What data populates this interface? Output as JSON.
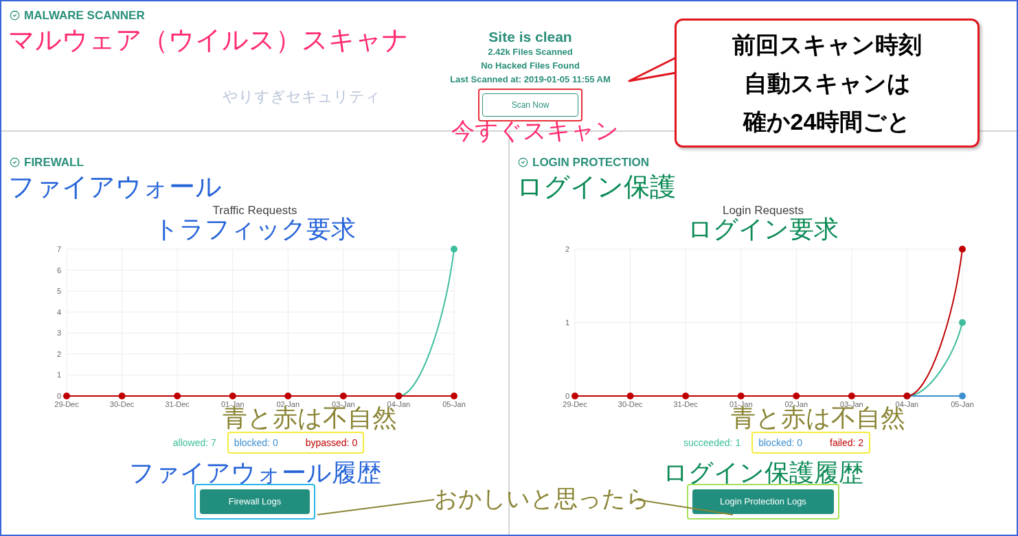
{
  "malware": {
    "title": "MALWARE SCANNER",
    "annotation": "マルウェア（ウイルス）スキャナ",
    "brand": "やりすぎセキュリティ",
    "status": "Site is clean",
    "files_scanned": "2.42k Files Scanned",
    "hacked": "No Hacked Files Found",
    "last_scanned": "Last Scanned at: 2019-01-05 11:55 AM",
    "button": "Scan Now",
    "button_annotation": "今すぐスキャン",
    "callout": [
      "前回スキャン時刻",
      "自動スキャンは",
      "確か24時間ごと"
    ]
  },
  "panels": [
    {
      "title": "FIREWALL",
      "annotation": "ファイアウォール",
      "color": "#2563d9",
      "chart_annotation": "トラフィック要求",
      "chart_data": {
        "type": "line",
        "title": "Traffic Requests",
        "grid": true,
        "categories": [
          "29-Dec",
          "30-Dec",
          "31-Dec",
          "01-Jan",
          "02-Jan",
          "03-Jan",
          "04-Jan",
          "05-Jan"
        ],
        "ylim": [
          0,
          7
        ],
        "yticks": [
          0,
          1,
          2,
          3,
          4,
          5,
          6,
          7
        ],
        "series": [
          {
            "color": "#3dbd9d",
            "marker": true,
            "values": [
              null,
              null,
              null,
              null,
              null,
              null,
              0,
              7
            ]
          },
          {
            "color": "#c00000",
            "marker": true,
            "values": [
              0,
              0,
              0,
              0,
              0,
              0,
              0,
              0
            ]
          }
        ]
      },
      "legend_note": "青と赤は不自然",
      "legend": [
        {
          "label": "allowed: 7",
          "color": "#3dbd9d",
          "highlighted": false
        },
        {
          "label": "blocked: 0",
          "color": "#3c8fd0",
          "highlighted": true
        },
        {
          "label": "bypassed: 0",
          "color": "#c00000",
          "highlighted": true
        }
      ],
      "logs_annotation": "ファイアウォール履歴",
      "button": "Firewall Logs"
    },
    {
      "title": "LOGIN PROTECTION",
      "annotation": "ログイン保護",
      "color": "#0b8a55",
      "chart_annotation": "ログイン要求",
      "chart_data": {
        "type": "line",
        "title": "Login Requests",
        "grid": true,
        "categories": [
          "29-Dec",
          "30-Dec",
          "31-Dec",
          "01-Jan",
          "02-Jan",
          "03-Jan",
          "04-Jan",
          "05-Jan"
        ],
        "ylim": [
          0,
          2
        ],
        "yticks": [
          0,
          1,
          2
        ],
        "series": [
          {
            "color": "#3dbd9d",
            "marker": true,
            "values": [
              null,
              null,
              null,
              null,
              null,
              null,
              0,
              1
            ]
          },
          {
            "color": "#3c8fd0",
            "marker": true,
            "values": [
              null,
              null,
              null,
              null,
              null,
              null,
              0,
              0
            ]
          },
          {
            "color": "#c00000",
            "marker": true,
            "values": [
              0,
              0,
              0,
              0,
              0,
              0,
              0,
              2
            ]
          }
        ]
      },
      "legend_note": "青と赤は不自然",
      "legend": [
        {
          "label": "succeeded: 1",
          "color": "#3dbd9d",
          "highlighted": false
        },
        {
          "label": "blocked: 0",
          "color": "#3c8fd0",
          "highlighted": true
        },
        {
          "label": "failed: 2",
          "color": "#c00000",
          "highlighted": true
        }
      ],
      "logs_annotation": "ログイン保護履歴",
      "button": "Login Protection Logs"
    }
  ],
  "shared_annotation": "おかしいと思ったら"
}
